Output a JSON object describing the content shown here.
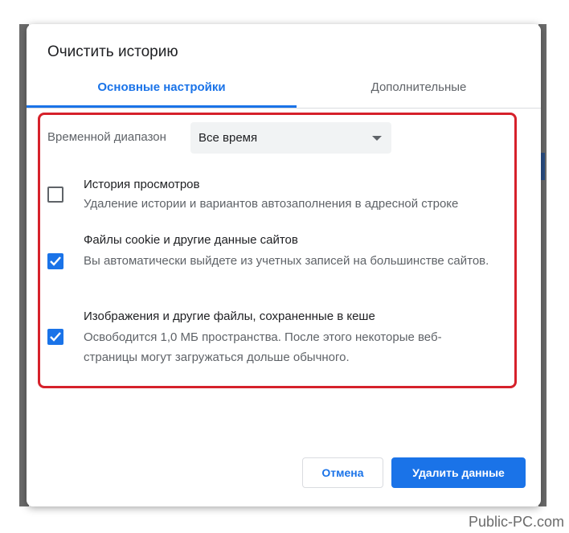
{
  "dialog": {
    "title": "Очистить историю"
  },
  "tabs": [
    {
      "label": "Основные настройки",
      "active": true
    },
    {
      "label": "Дополнительные",
      "active": false
    }
  ],
  "time_range": {
    "label": "Временной диапазон",
    "selected": "Все время"
  },
  "items": [
    {
      "title": "История просмотров",
      "description": "Удаление истории и вариантов автозаполнения в адресной строке",
      "checked": false
    },
    {
      "title": "Файлы cookie и другие данные сайтов",
      "description": "Вы автоматически выйдете из учетных записей на большинстве сайтов.",
      "checked": true
    },
    {
      "title": "Изображения и другие файлы, сохраненные в кеше",
      "description": "Освободится 1,0 МБ пространства. После этого некоторые веб-страницы могут загружаться дольше обычного.",
      "checked": true
    }
  ],
  "buttons": {
    "cancel": "Отмена",
    "delete": "Удалить данные"
  },
  "watermark": "Public-PC.com",
  "colors": {
    "accent": "#1a73e8",
    "highlight": "#d6212b"
  }
}
